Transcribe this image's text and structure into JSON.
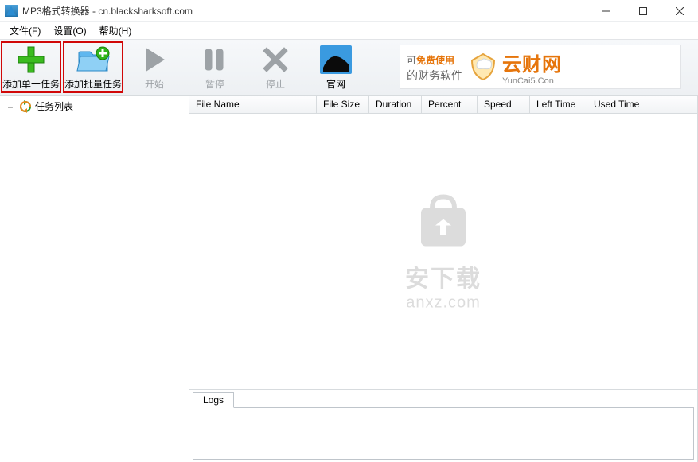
{
  "window": {
    "title": "MP3格式转换器 - cn.blacksharksoft.com"
  },
  "menu": {
    "file": "文件(F)",
    "settings": "设置(O)",
    "help": "帮助(H)"
  },
  "toolbar": {
    "add_single": "添加单一任务",
    "add_batch": "添加批量任务",
    "start": "开始",
    "pause": "暂停",
    "stop": "停止",
    "official": "官网"
  },
  "banner": {
    "line1_prefix": "可",
    "line1_strong": "免费使用",
    "line2": "的财务软件",
    "brand": "云财网",
    "brand_sub": "YunCai5.Con"
  },
  "sidebar": {
    "task_list": "任务列表"
  },
  "columns": {
    "c0": "File Name",
    "c1": "File Size",
    "c2": "Duration",
    "c3": "Percent",
    "c4": "Speed",
    "c5": "Left Time",
    "c6": "Used Time"
  },
  "watermark": {
    "line1": "安下载",
    "line2": "anxz.com"
  },
  "logs": {
    "tab": "Logs"
  }
}
